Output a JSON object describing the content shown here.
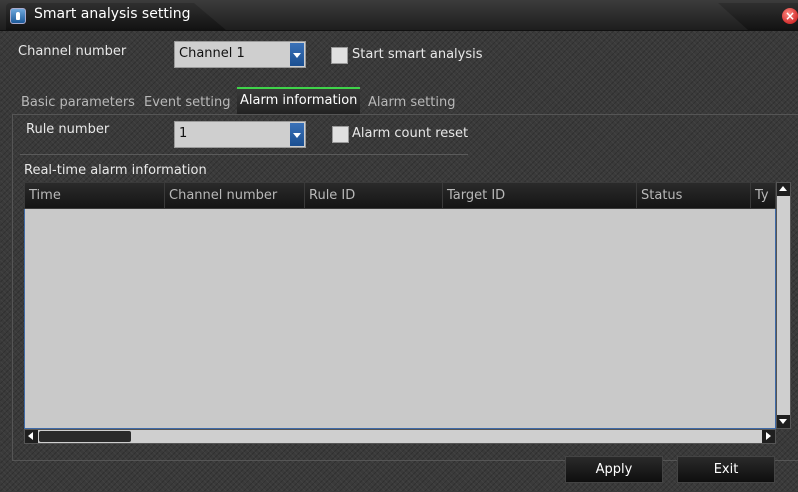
{
  "window": {
    "title": "Smart analysis setting",
    "close_glyph": "×",
    "icon": "app-icon"
  },
  "channel": {
    "label": "Channel number",
    "value": "Channel 1"
  },
  "smart_analysis": {
    "label": "Start smart analysis",
    "checked": false
  },
  "tabs": [
    {
      "label": "Basic parameters",
      "active": false
    },
    {
      "label": "Event setting",
      "active": false
    },
    {
      "label": "Alarm information",
      "active": true
    },
    {
      "label": "Alarm setting",
      "active": false
    }
  ],
  "rule": {
    "label": "Rule number",
    "value": "1"
  },
  "alarm_reset": {
    "label": "Alarm count reset",
    "checked": false
  },
  "realtime": {
    "title": "Real-time alarm information",
    "columns": [
      "Time",
      "Channel number",
      "Rule ID",
      "Target ID",
      "Status",
      "Ty"
    ],
    "rows": []
  },
  "buttons": {
    "apply": "Apply",
    "exit": "Exit"
  },
  "colors": {
    "active_tab_accent": "#3fd34a",
    "dropdown_arrow": "#1b4f91",
    "close_button": "#d32f2f"
  }
}
